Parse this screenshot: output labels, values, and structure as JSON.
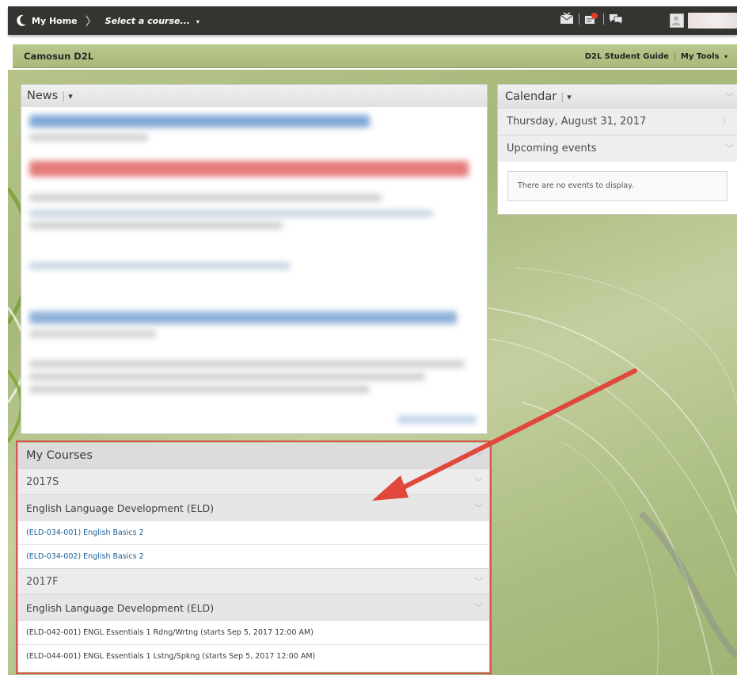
{
  "topbar": {
    "home_label": "My Home",
    "course_selector_label": "Select a course...",
    "course_selector_caret": "▾"
  },
  "orgbar": {
    "org_name": "Camosun D2L",
    "student_guide": "D2L Student Guide",
    "my_tools": "My Tools",
    "my_tools_caret": "▾"
  },
  "news": {
    "title": "News",
    "menu_caret": "▾"
  },
  "calendar": {
    "title": "Calendar",
    "menu_caret": "▾",
    "date": "Thursday, August 31, 2017",
    "upcoming": "Upcoming events",
    "empty_message": "There are no events to display."
  },
  "courses": {
    "title": "My Courses",
    "groups": [
      {
        "term": "2017S",
        "department": "English Language Development (ELD)",
        "items": [
          "(ELD-034-001) English Basics 2",
          "(ELD-034-002) English Basics 2"
        ]
      },
      {
        "term": "2017F",
        "department": "English Language Development (ELD)",
        "items": [
          "(ELD-042-001) ENGL Essentials 1 Rdng/Wrtng (starts Sep 5, 2017 12:00 AM)",
          "(ELD-044-001) ENGL Essentials 1 Lstng/Spkng (starts Sep 5, 2017 12:00 AM)"
        ]
      }
    ]
  },
  "colors": {
    "topbar": "#343431",
    "org_bar": "#b3c386",
    "link": "#1c5d99",
    "highlight_box": "#d9534f",
    "arrow": "#e0483c"
  },
  "icons": {
    "home": "crescent-moon-icon",
    "mail": "mail-icon",
    "notifications": "notification-icon",
    "chat": "chat-icon",
    "expand": "chevron-down-icon",
    "go": "chevron-right-icon"
  }
}
